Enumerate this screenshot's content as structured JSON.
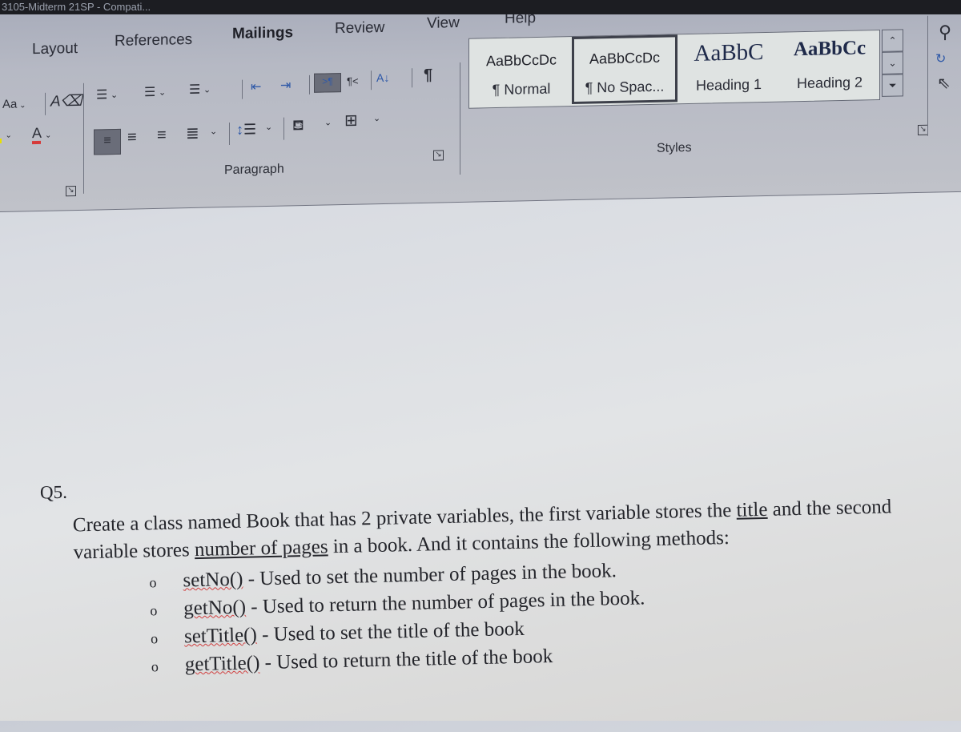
{
  "window": {
    "title": "3105-Midterm 21SP - Compati..."
  },
  "ribbon": {
    "tabs": [
      {
        "label": "Layout"
      },
      {
        "label": "References"
      },
      {
        "label": "Mailings"
      },
      {
        "label": "Review"
      },
      {
        "label": "View"
      },
      {
        "label": "Help"
      }
    ],
    "font_group": {
      "change_case_label": "Aa",
      "clear_formatting_label": "A",
      "font_color_label": "A",
      "font_color": "#d63a3a",
      "highlight_color": "#e8e000"
    },
    "paragraph_group": {
      "label": "Paragraph",
      "icons": {
        "ltr": ">¶",
        "rtl": "¶<",
        "sort": "A↓",
        "show_marks": "¶"
      }
    },
    "styles_group": {
      "label": "Styles",
      "items": [
        {
          "preview": "AaBbCcDc",
          "name": "¶ Normal",
          "selected": false
        },
        {
          "preview": "AaBbCcDc",
          "name": "¶ No Spac...",
          "selected": true
        },
        {
          "preview": "AaBbC",
          "name": "Heading 1",
          "selected": false
        },
        {
          "preview": "AaBbCc",
          "name": "Heading 2",
          "selected": false
        }
      ]
    }
  },
  "document": {
    "question_number": "Q5.",
    "paragraph": {
      "part1": "Create a class named Book that has 2 private variables, the first variable stores the ",
      "underline1": "title",
      "part2": " and the second variable stores ",
      "underline2": "number of pages",
      "part3": " in a book. And it contains the following methods:"
    },
    "methods": [
      {
        "name": "setNo()",
        "desc": " - Used to set the number of pages in the book."
      },
      {
        "name": "getNo()",
        "desc": " - Used to return the number of pages in the book."
      },
      {
        "name": "setTitle()",
        "desc": " - Used to set the title of the book"
      },
      {
        "name": "getTitle()",
        "desc": " - Used to return the title of the book"
      }
    ],
    "bullet": "o"
  }
}
